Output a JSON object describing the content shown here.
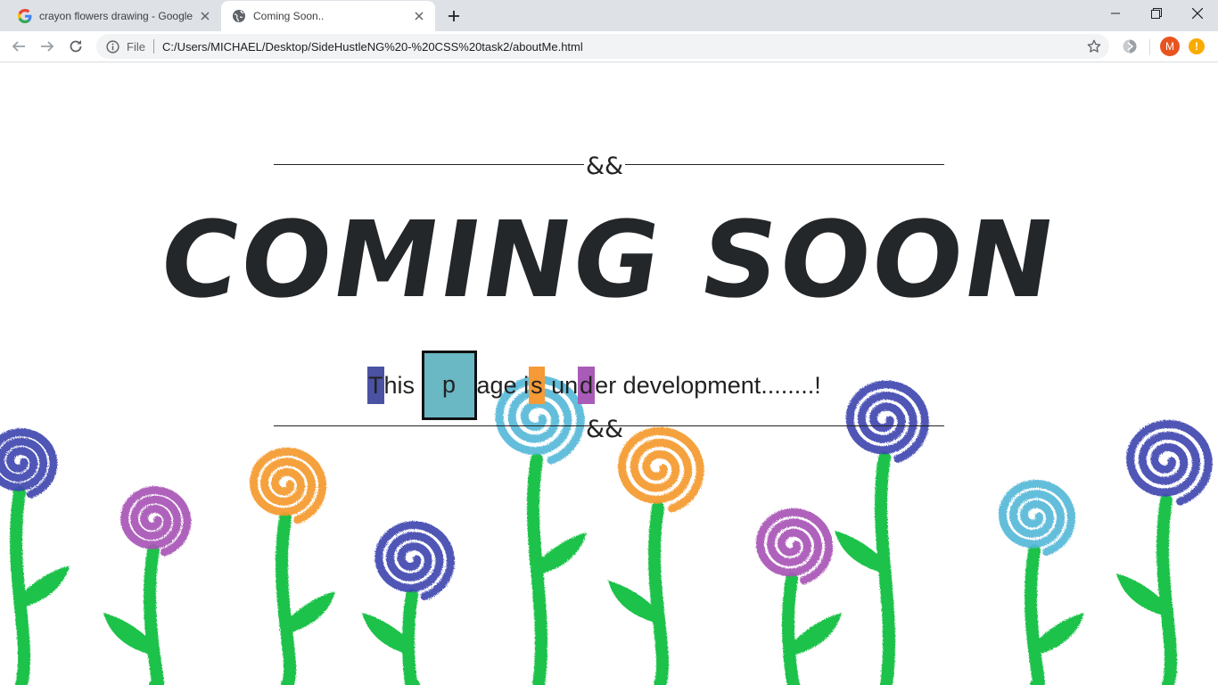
{
  "browser": {
    "tabs": [
      {
        "title": "crayon flowers drawing - Google",
        "favicon": "google-icon",
        "active": false
      },
      {
        "title": "Coming Soon..",
        "favicon": "globe-icon",
        "active": true
      }
    ],
    "omnibox": {
      "scheme": "File",
      "url": "C:/Users/MICHAEL/Desktop/SideHustleNG%20-%20CSS%20task2/aboutMe.html"
    },
    "profile_initial": "M",
    "alert_symbol": "!"
  },
  "page": {
    "ornament_top": "&&",
    "ornament_bottom": "&&",
    "headline": "COMING SOON",
    "tagline": {
      "seg1": "T",
      "seg2": "his ",
      "seg3": "p",
      "seg4": "age i",
      "seg5": "s",
      "seg6": " un",
      "seg7": "d",
      "seg8": "er development........!"
    }
  },
  "colors": {
    "tag_blue": "#4b52a3",
    "tag_teal": "#69b8c4",
    "tag_orange": "#f59a37",
    "tag_purple": "#a85bb7",
    "flower_blue": "#3f48b0",
    "flower_purple": "#a855b5",
    "flower_orange": "#f4992d",
    "flower_cyan": "#56b9d8",
    "stem_green": "#1fc24a"
  }
}
